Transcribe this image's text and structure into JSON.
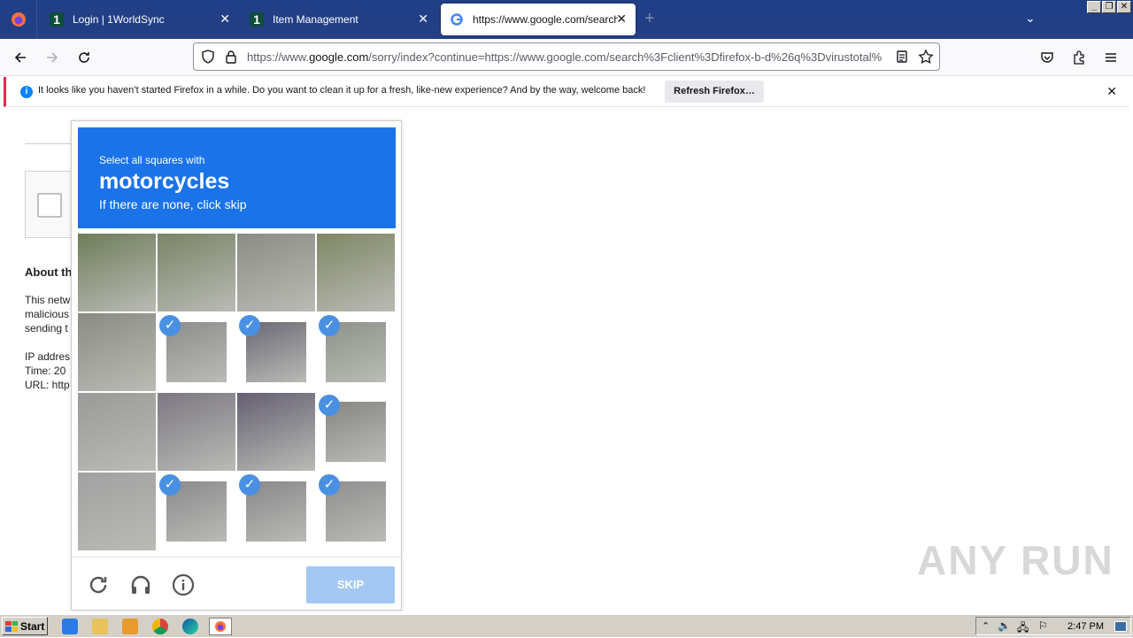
{
  "browser": {
    "tabs": [
      {
        "title": "Login | 1WorldSync",
        "icon": "1worldsync-icon"
      },
      {
        "title": "Item Management",
        "icon": "1worldsync-icon"
      },
      {
        "title": "https://www.google.com/search?c",
        "icon": "google-icon",
        "active": true
      }
    ],
    "url_prefix": "https://www.",
    "url_domain": "google.com",
    "url_rest": "/sorry/index?continue=https://www.google.com/search%3Fclient%3Dfirefox-b-d%26q%3Dvirustotal%"
  },
  "notification": {
    "message": "It looks like you haven’t started Firefox in a while. Do you want to clean it up for a fresh, like-new experience? And by the way, welcome back!",
    "button": "Refresh Firefox…"
  },
  "page": {
    "about_heading": "About th",
    "lines": [
      "This netw",
      "malicious",
      "sending t",
      "IP addres",
      "Time: 20",
      "URL: http"
    ]
  },
  "captcha": {
    "instruction": "Select all squares with",
    "target": "motorcycles",
    "hint": "If there are none, click skip",
    "skip_label": "SKIP",
    "tiles": [
      {
        "selected": false,
        "tone": "#6f7d5a"
      },
      {
        "selected": false,
        "tone": "#7a8466"
      },
      {
        "selected": false,
        "tone": "#8a8d85"
      },
      {
        "selected": false,
        "tone": "#7f8765"
      },
      {
        "selected": false,
        "tone": "#8a8c84"
      },
      {
        "selected": true,
        "tone": "#8d8e8c"
      },
      {
        "selected": true,
        "tone": "#6b6976"
      },
      {
        "selected": true,
        "tone": "#8f918b"
      },
      {
        "selected": false,
        "tone": "#9a9a98"
      },
      {
        "selected": false,
        "tone": "#7c7782"
      },
      {
        "selected": false,
        "tone": "#655f72"
      },
      {
        "selected": true,
        "tone": "#868783"
      },
      {
        "selected": false,
        "tone": "#a1a1a1"
      },
      {
        "selected": true,
        "tone": "#8a8a8c"
      },
      {
        "selected": true,
        "tone": "#88888a"
      },
      {
        "selected": true,
        "tone": "#8f8f8f"
      }
    ]
  },
  "watermark": "ANY RUN",
  "taskbar": {
    "start_label": "Start",
    "clock": "2:47 PM"
  },
  "colors": {
    "captcha_blue": "#1a73e8",
    "check_blue": "#4a90e2",
    "skip_disabled": "#a5c8f3"
  }
}
